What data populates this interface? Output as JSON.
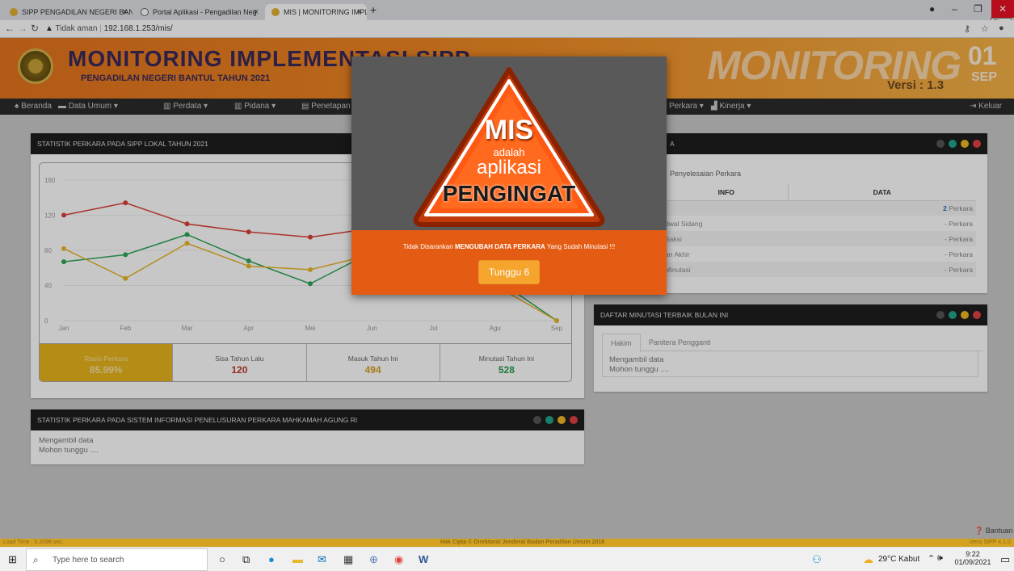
{
  "browser": {
    "tabs": [
      {
        "title": "SIPP PENGADILAN NEGERI BANT",
        "active": false
      },
      {
        "title": "Portal Aplikasi - Pengadilan Neg",
        "active": false
      },
      {
        "title": "MIS | MONITORING IMPLEMENT",
        "active": true
      }
    ],
    "new_tab": "+",
    "close_tooltip": "Close",
    "security_label": "Tidak aman",
    "url": "192.168.1.253/mis/"
  },
  "header": {
    "title": "MONITORING IMPLEMENTASI SIPP",
    "subtitle": "PENGADILAN NEGERI BANTUL TAHUN 2021",
    "bg_word": "MONITORING",
    "version": "Versi : 1.3",
    "day": "01",
    "month": "SEP"
  },
  "menu": {
    "items": [
      "Beranda",
      "Data Umum ▾",
      "Perdata ▾",
      "Pidana ▾",
      "Penetapan",
      "Perkara ▾",
      "Kinerja ▾"
    ],
    "logout": "Keluar"
  },
  "stat_panel": {
    "title": "STATISTIK PERKARA PADA SIPP LOKAL TAHUN 2021",
    "stats": [
      {
        "label": "Rasio Perkara",
        "value": "85.99%"
      },
      {
        "label": "Sisa Tahun Lalu",
        "value": "120"
      },
      {
        "label": "Masuk Tahun Ini",
        "value": "494"
      },
      {
        "label": "Minutasi Tahun Ini",
        "value": "528"
      }
    ]
  },
  "chart_data": {
    "type": "line",
    "categories": [
      "Jan",
      "Feb",
      "Mar",
      "Apr",
      "Mei",
      "Jun",
      "Jul",
      "Agu",
      "Sep"
    ],
    "yticks": [
      0,
      40,
      80,
      120,
      160
    ],
    "ylim": [
      0,
      170
    ],
    "colors": [
      "#d9403a",
      "#2ea65a",
      "#e8b62a"
    ],
    "series": [
      {
        "values": [
          120,
          134,
          110,
          101,
          95,
          105,
          null,
          null,
          null
        ]
      },
      {
        "values": [
          67,
          75,
          98,
          68,
          42,
          78,
          null,
          48,
          0
        ]
      },
      {
        "values": [
          82,
          48,
          88,
          62,
          58,
          75,
          null,
          40,
          0
        ]
      }
    ]
  },
  "info_panel": {
    "title_suffix": "A",
    "tab": "Penyelesaian Perkara",
    "headers": [
      "INFO",
      "DATA"
    ],
    "rows": [
      {
        "info": "",
        "data_num": "2",
        "data_unit": "Perkara"
      },
      {
        "info": "dwal Sidang",
        "data_num": "-",
        "data_unit": "Perkara"
      },
      {
        "info": "Saksi",
        "data_num": "-",
        "data_unit": "Perkara"
      },
      {
        "info": "an Akhir",
        "data_num": "-",
        "data_unit": "Perkara"
      },
      {
        "info": "Minutasi",
        "data_num": "-",
        "data_unit": "Perkara"
      }
    ]
  },
  "minutasi_panel": {
    "title": "DAFTAR MINUTASI TERBAIK BULAN INI",
    "tabs": [
      "Hakim",
      "Panitera Pengganti"
    ],
    "loading_1": "Mengambil data",
    "loading_2": "Mohon tunggu ...."
  },
  "sipp_panel": {
    "title": "STATISTIK PERKARA PADA SISTEM INFORMASI PENELUSURAN PERKARA MAHKAMAH AGUNG RI",
    "loading_1": "Mengambil data",
    "loading_2": "Mohon tunggu ...."
  },
  "help": "Bantuan",
  "footer": {
    "load_time": "Load Time : 0.2098 sec.",
    "copyright": "Hak Cipta © Direktorat Jenderal Badan Peradilan Umum 2018",
    "version": "Versi SIPP 4.1.0"
  },
  "modal": {
    "badge_title": "MIS",
    "badge_l2": "adalah",
    "badge_l3": "aplikasi",
    "badge_l4": "PENGINGAT",
    "warning_pre": "Tidak Disarankan ",
    "warning_bold": "MENGUBAH DATA PERKARA",
    "warning_post": " Yang Sudah Minutasi !!!",
    "button": "Tunggu 6"
  },
  "taskbar": {
    "search_placeholder": "Type here to search",
    "weather": "29°C Kabut",
    "time": "9:22",
    "date": "01/09/2021"
  }
}
